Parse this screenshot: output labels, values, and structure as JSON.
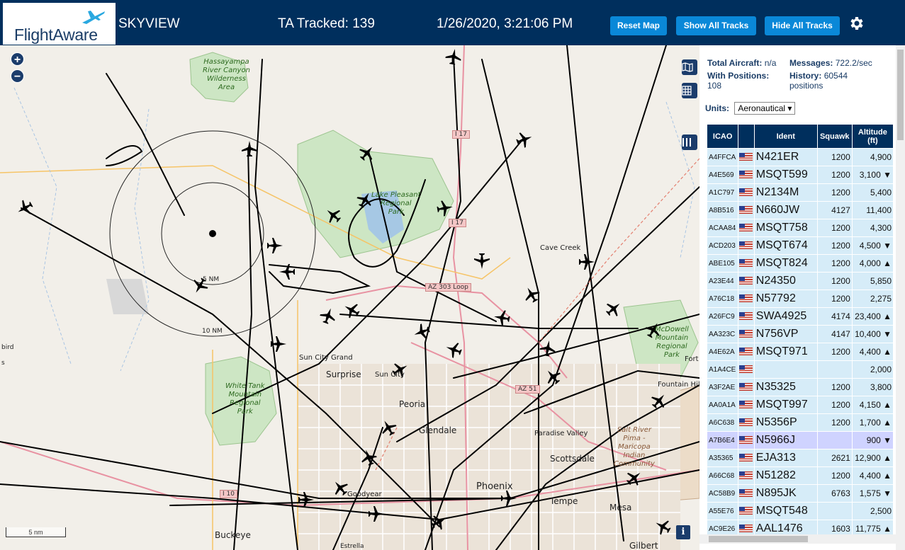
{
  "header": {
    "logo_text": "FlightAware",
    "app_title": "SKYVIEW",
    "ta_tracked": "TA Tracked: 139",
    "datetime": "1/26/2020, 3:21:06 PM",
    "buttons": {
      "reset_map": "Reset Map",
      "show_all_tracks": "Show All Tracks",
      "hide_all_tracks": "Hide All Tracks"
    },
    "settings_icon": "gear-icon"
  },
  "map": {
    "zoom_in": "+",
    "zoom_out": "−",
    "scale_label": "5 nm",
    "info": "i",
    "ring_labels": [
      "5 NM",
      "10 NM"
    ],
    "park_labels": [
      [
        "Hassayampa",
        "River Canyon",
        "Wilderness",
        "Area"
      ],
      [
        "Lake Pleasant",
        "Regional",
        "Park"
      ],
      [
        "White Tank",
        "Mountain",
        "Regional",
        "Park"
      ],
      [
        "McDowell",
        "Mountain",
        "Regional",
        "Park"
      ],
      [
        "Salt River",
        "Pima -",
        "Maricopa",
        "Indian",
        "Community"
      ]
    ],
    "city_labels": [
      "Cave Creek",
      "Sun City Grand",
      "Surprise",
      "Sun City",
      "Peoria",
      "Glendale",
      "Paradise Valley",
      "Scottsdale",
      "Phoenix",
      "Tempe",
      "Mesa",
      "Goodyear",
      "Buckeye",
      "Fountain Hills",
      "Fort",
      "Gilbert",
      "Estrella",
      "bird",
      "s"
    ],
    "highway_labels": [
      "I 17",
      "I 17",
      "AZ 303 Loop",
      "AZ 51",
      "I 10"
    ]
  },
  "sidebar": {
    "stats": {
      "total_aircraft_label": "Total Aircraft:",
      "total_aircraft_value": "n/a",
      "messages_label": "Messages:",
      "messages_value": "722.2/sec",
      "with_positions_label": "With Positions:",
      "with_positions_value": "108",
      "history_label": "History:",
      "history_value": "60544",
      "history_unit": "positions"
    },
    "units_label": "Units:",
    "units_value": "Aeronautical",
    "table": {
      "headers": {
        "icao": "ICAO",
        "flag": "",
        "ident": "Ident",
        "squawk": "Squawk",
        "altitude_line1": "Altitude",
        "altitude_line2": "(ft)"
      },
      "rows": [
        {
          "icao": "A4FFCA",
          "ident": "N421ER",
          "squawk": "1200",
          "altitude": "4,900"
        },
        {
          "icao": "A4E569",
          "ident": "MSQT599",
          "squawk": "1200",
          "altitude": "3,100 ▼"
        },
        {
          "icao": "A1C797",
          "ident": "N2134M",
          "squawk": "1200",
          "altitude": "5,400"
        },
        {
          "icao": "A8B516",
          "ident": "N660JW",
          "squawk": "4127",
          "altitude": "11,400"
        },
        {
          "icao": "ACAA84",
          "ident": "MSQT758",
          "squawk": "1200",
          "altitude": "4,300"
        },
        {
          "icao": "ACD203",
          "ident": "MSQT674",
          "squawk": "1200",
          "altitude": "4,500 ▼"
        },
        {
          "icao": "ABE105",
          "ident": "MSQT824",
          "squawk": "1200",
          "altitude": "4,000 ▲"
        },
        {
          "icao": "A23E44",
          "ident": "N24350",
          "squawk": "1200",
          "altitude": "5,850"
        },
        {
          "icao": "A76C18",
          "ident": "N57792",
          "squawk": "1200",
          "altitude": "2,275"
        },
        {
          "icao": "A26FC9",
          "ident": "SWA4925",
          "squawk": "4174",
          "altitude": "23,400 ▲"
        },
        {
          "icao": "AA323C",
          "ident": "N756VP",
          "squawk": "4147",
          "altitude": "10,400 ▼"
        },
        {
          "icao": "A4E62A",
          "ident": "MSQT971",
          "squawk": "1200",
          "altitude": "4,400 ▲"
        },
        {
          "icao": "A1A4CE",
          "ident": "",
          "squawk": "",
          "altitude": "2,000"
        },
        {
          "icao": "A3F2AE",
          "ident": "N35325",
          "squawk": "1200",
          "altitude": "3,800"
        },
        {
          "icao": "AA0A1A",
          "ident": "MSQT997",
          "squawk": "1200",
          "altitude": "4,150 ▲"
        },
        {
          "icao": "A6C638",
          "ident": "N5356P",
          "squawk": "1200",
          "altitude": "1,700 ▲"
        },
        {
          "icao": "A7B6E4",
          "ident": "N5966J",
          "squawk": "",
          "altitude": "900 ▼",
          "selected": true
        },
        {
          "icao": "A35365",
          "ident": "EJA313",
          "squawk": "2621",
          "altitude": "12,900 ▲"
        },
        {
          "icao": "A66C68",
          "ident": "N51282",
          "squawk": "1200",
          "altitude": "4,400 ▲"
        },
        {
          "icao": "AC58B9",
          "ident": "N895JK",
          "squawk": "6763",
          "altitude": "1,575 ▼"
        },
        {
          "icao": "A55E76",
          "ident": "MSQT548",
          "squawk": "",
          "altitude": "2,500"
        },
        {
          "icao": "AC9E26",
          "ident": "AAL1476",
          "squawk": "1603",
          "altitude": "11,775 ▲"
        }
      ]
    }
  },
  "colors": {
    "header_bg": "#002f5d",
    "button_bg": "#0a88d8",
    "table_header_bg": "#002f5d",
    "row_bg": "#d6ecf8",
    "row_selected_bg": "#cfd3ff",
    "map_bg": "#f2efe9"
  }
}
